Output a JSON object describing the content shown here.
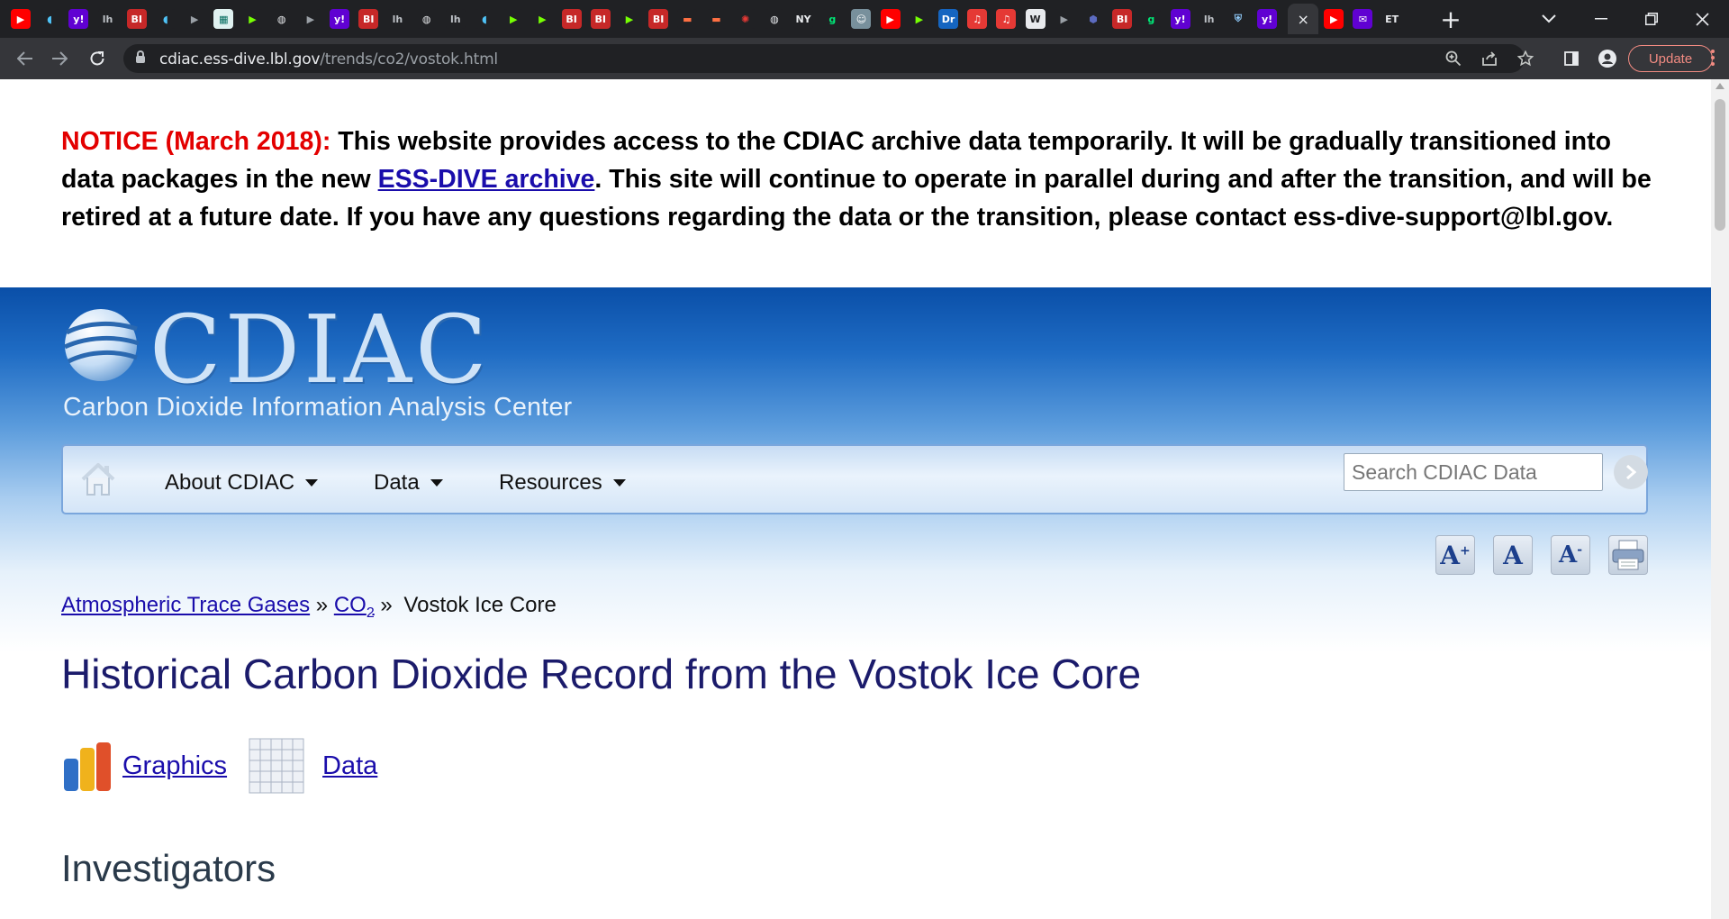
{
  "browser": {
    "tab_favicons": [
      "youtube",
      "shield",
      "yahoo",
      "lh",
      "bi",
      "shield",
      "flag",
      "grid",
      "play-green",
      "globe",
      "flag",
      "yahoo",
      "bi",
      "lh",
      "globe",
      "lh",
      "shield",
      "play-green",
      "play-green",
      "bi",
      "bi",
      "play-green",
      "bi",
      "bookmark-orange",
      "bookmark-orange",
      "burst",
      "globe",
      "nyt",
      "g-green",
      "face",
      "youtube",
      "play-green",
      "dr",
      "mic-red",
      "mic-red",
      "wp",
      "flag",
      "hex",
      "bi",
      "g-green",
      "yahoo",
      "lh",
      "crest",
      "yahoo"
    ],
    "active_tab_close": "×",
    "after_tabs": [
      "youtube",
      "mail-purple",
      "et"
    ],
    "new_tab_label": "+",
    "url_host": "cdiac.ess-dive.lbl.gov",
    "url_path": "/trends/co2/vostok.html",
    "update_label": "Update",
    "colors": {
      "tabstrip": "#202124",
      "toolbar": "#35363a",
      "update": "#f28b82"
    }
  },
  "notice": {
    "prefix": "NOTICE (March 2018):",
    "text_before_link": " This website provides access to the CDIAC archive data temporarily. It will be gradually transitioned into data packages in the new ",
    "link_text": "ESS-DIVE archive",
    "text_after_link": ". This site will continue to operate in parallel during and after the transition, and will be retired at a future date. If you have any questions regarding the data or the transition, please contact ess-dive-support@lbl.gov."
  },
  "header": {
    "logo_text": "CDIAC",
    "logo_subtitle": "Carbon Dioxide Information Analysis Center"
  },
  "nav": {
    "items": [
      {
        "label": "About CDIAC"
      },
      {
        "label": "Data"
      },
      {
        "label": "Resources"
      }
    ],
    "search_placeholder": "Search CDIAC Data"
  },
  "tools": {
    "increase_text": "A+",
    "normal_text": "A",
    "decrease_text": "A-"
  },
  "breadcrumb": {
    "item1": "Atmospheric Trace Gases",
    "separator": "»",
    "item2": "CO",
    "item2_sub": "2",
    "current": "Vostok Ice Core"
  },
  "page": {
    "title": "Historical Carbon Dioxide Record from the Vostok Ice Core",
    "links": {
      "graphics": "Graphics",
      "data": "Data"
    },
    "section_investigators": "Investigators"
  }
}
